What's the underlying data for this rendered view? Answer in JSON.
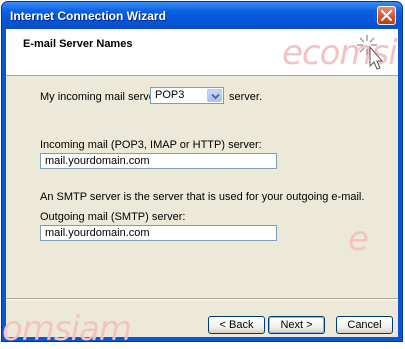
{
  "window": {
    "title": "Internet Connection Wizard"
  },
  "header": {
    "title": "E-mail Server Names"
  },
  "watermark": {
    "text_top": "ecomsiam",
    "text_mid": "e",
    "text_bottom": "omsiam"
  },
  "form": {
    "incoming_type_prefix": "My incoming mail server is a",
    "incoming_type_value": "POP3",
    "incoming_type_suffix": "server.",
    "incoming_label": "Incoming mail (POP3, IMAP or HTTP) server:",
    "incoming_value": "mail.yourdomain.com",
    "smtp_note": "An SMTP server is the server that is used for your outgoing e-mail.",
    "outgoing_label": "Outgoing mail (SMTP) server:",
    "outgoing_value": "mail.yourdomain.com"
  },
  "buttons": {
    "back": "< Back",
    "next": "Next >",
    "cancel": "Cancel"
  },
  "colors": {
    "titlebar": "#0a5fe2",
    "dialog_bg": "#ece9d8",
    "watermark": "#f3c3c3"
  }
}
